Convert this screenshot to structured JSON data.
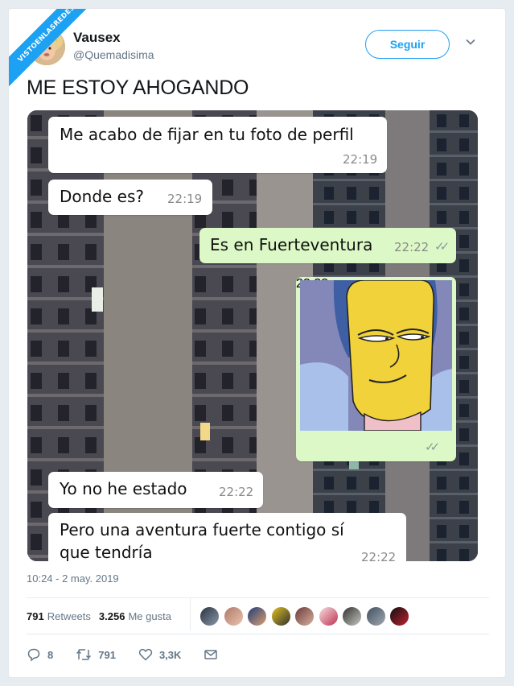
{
  "watermark": "VISTOENLASREDES",
  "user": {
    "name": "Vausex",
    "handle": "@Quemadisima"
  },
  "follow_label": "Seguir",
  "tweet_text": "ME ESTOY AHOGANDO",
  "chat": {
    "messages": [
      {
        "direction": "in",
        "text": "Me acabo de fijar en tu foto de perfil",
        "time": "22:19"
      },
      {
        "direction": "in",
        "text": "Donde es?",
        "time": "22:19"
      },
      {
        "direction": "out",
        "text": "Es en Fuerteventura",
        "time": "22:22",
        "ticks": "✓✓"
      },
      {
        "direction": "out",
        "type": "image",
        "image_desc": "marge-simpson-icon",
        "time": "22:22",
        "ticks": "✓✓"
      },
      {
        "direction": "in",
        "text": "Yo no he estado",
        "time": "22:22"
      },
      {
        "direction": "in",
        "text": "Pero una aventura fuerte contigo sí\nque tendría",
        "time": "22:22"
      }
    ]
  },
  "timestamp": "10:24 - 2 may. 2019",
  "stats": {
    "retweets_count": "791",
    "retweets_label": "Retweets",
    "likes_count": "3.256",
    "likes_label": "Me gusta"
  },
  "actions": {
    "replies": "8",
    "retweets": "791",
    "likes": "3,3K"
  },
  "colors": {
    "accent": "#1da1f2",
    "bubble_out": "#dcf8c6",
    "bubble_in": "#ffffff"
  }
}
